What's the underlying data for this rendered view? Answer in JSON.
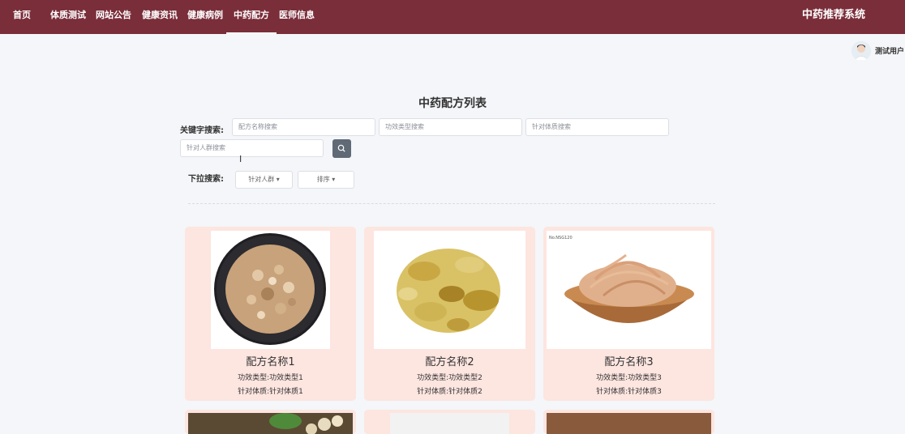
{
  "nav": {
    "items": [
      "首页",
      "体质测试",
      "网站公告",
      "健康资讯",
      "健康病例",
      "中药配方",
      "医师信息"
    ],
    "active_index": 5,
    "brand": "中药推荐系统"
  },
  "user": {
    "name": "测试用户"
  },
  "main": {
    "title": "中药配方列表",
    "keyword_label": "关键字搜索:",
    "search_placeholders": [
      "配方名称搜索",
      "功效类型搜索",
      "针对体质搜索",
      "针对人群搜索"
    ],
    "dropdown_label": "下拉搜索:",
    "dropdowns": [
      "针对人群",
      "排序"
    ]
  },
  "cards": [
    {
      "name": "配方名称1",
      "effect": "功效类型:功效类型1",
      "constitution": "针对体质:针对体质1"
    },
    {
      "name": "配方名称2",
      "effect": "功效类型:功效类型2",
      "constitution": "针对体质:针对体质2"
    },
    {
      "name": "配方名称3",
      "effect": "功效类型:功效类型3",
      "constitution": "针对体质:针对体质3"
    }
  ],
  "image_watermark": "No.NSG120",
  "colors": {
    "nav_bg": "#7a2e3a",
    "card_bg": "#fde5e0",
    "search_button": "#606a76"
  }
}
